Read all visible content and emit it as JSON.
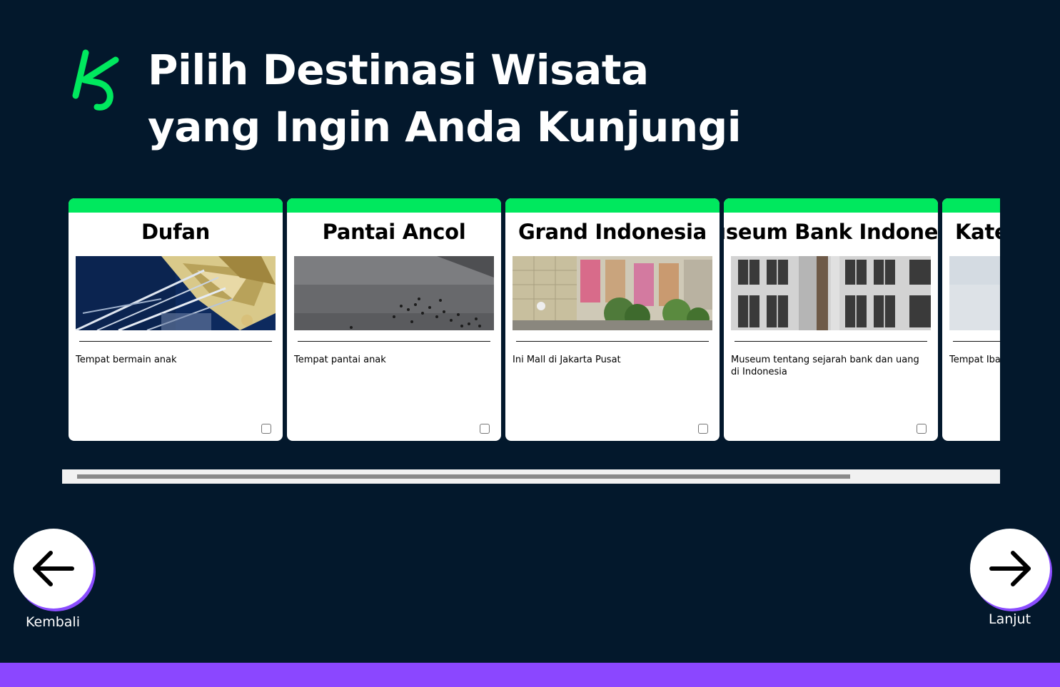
{
  "header": {
    "title_line1": "Pilih Destinasi Wisata",
    "title_line2": "yang Ingin Anda Kunjungi",
    "logo_icon": "ks-logo-icon"
  },
  "destinations": [
    {
      "name": "Dufan",
      "description": "Tempat bermain anak",
      "checked": false
    },
    {
      "name": "Pantai Ancol",
      "description": "Tempat pantai anak",
      "checked": false
    },
    {
      "name": "Grand Indonesia",
      "description": "Ini Mall di Jakarta Pusat",
      "checked": false
    },
    {
      "name": "Museum Bank Indonesia",
      "description": "Museum tentang sejarah bank dan uang di Indonesia",
      "checked": false
    },
    {
      "name": "Kate",
      "description": "Tempat Iba",
      "checked": false
    }
  ],
  "navigation": {
    "back_label": "Kembali",
    "next_label": "Lanjut",
    "back_icon": "arrow-left-icon",
    "next_icon": "arrow-right-icon"
  },
  "colors": {
    "background": "#03182c",
    "accent_green": "#00e85e",
    "accent_purple": "#8b47ff"
  }
}
